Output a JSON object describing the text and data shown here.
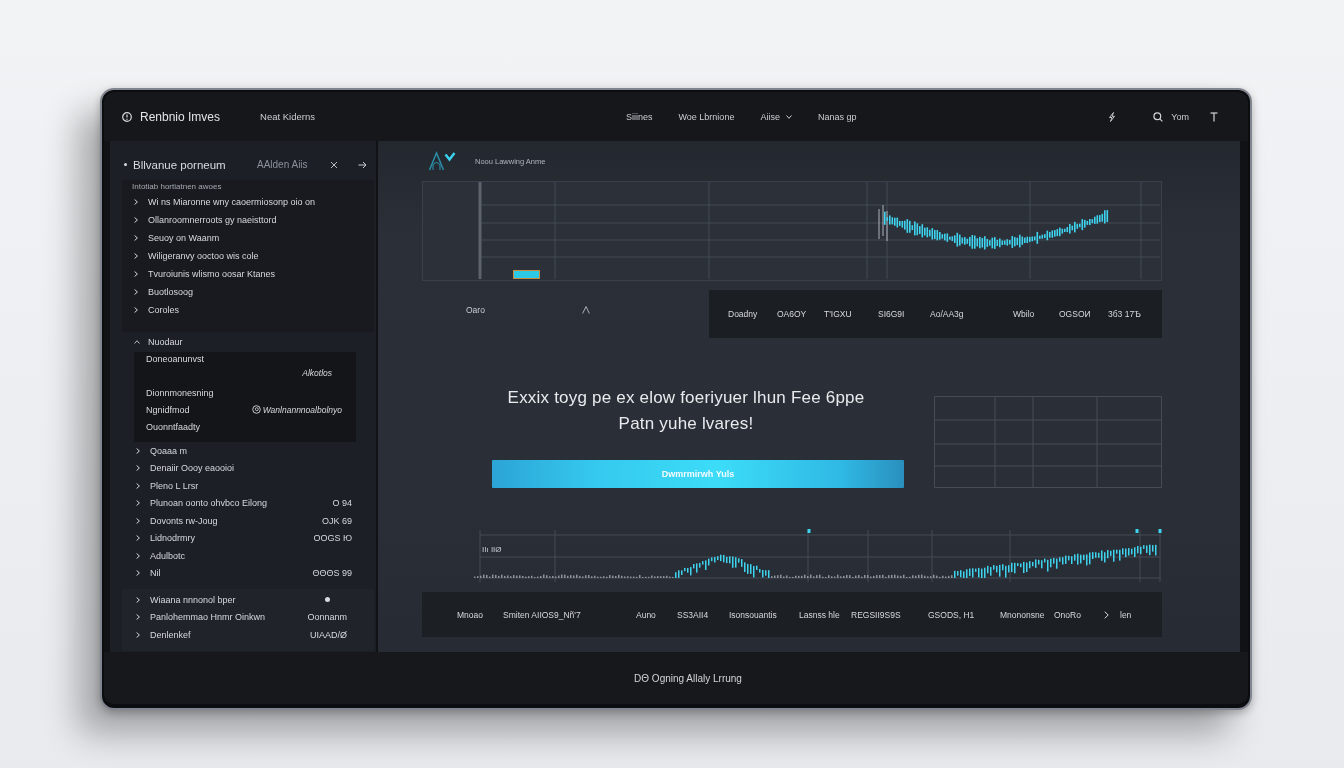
{
  "top_bar": {
    "brand": "Renbnio Imves",
    "workspace": "Neat Kiderns",
    "nav": [
      {
        "label": "Siiines",
        "dropdown": false
      },
      {
        "label": "Woe Lbrnione",
        "dropdown": false
      },
      {
        "label": "Aiise",
        "dropdown": true
      },
      {
        "label": "Nanas gp",
        "dropdown": false
      }
    ],
    "account": "Yom"
  },
  "sidebar": {
    "header": {
      "title": "Bllvanue porneum",
      "tag": "AAlden Aiis"
    },
    "caption": "Intotiab hortiatnen awoes",
    "items": [
      "Wi ns Miaronne wny caoermiosonp oio on",
      "Ollanroomnerroots gy naeisttord",
      "Seuoy on Waanm",
      "Wiligeranvy ooctoo wis cole",
      "Tvuroiunis wlismo oosar Ktanes",
      "Buotlosoog",
      "Coroles"
    ],
    "section": {
      "title": "Nuodaur",
      "expanded": true,
      "details": [
        {
          "kind": "plain",
          "label": "Doneoanunvst",
          "value": "Alkotlos"
        },
        {
          "kind": "plain",
          "label": "Dionnmonesning"
        },
        {
          "kind": "linked",
          "label": "Ngnidfmod",
          "value": "Wanlnannnoalbolnyo"
        },
        {
          "kind": "plain",
          "label": "Ouonntfaadty"
        }
      ],
      "items": [
        {
          "label": "Qoaaa m"
        },
        {
          "label": "Denaiir Oooy eaooioi"
        },
        {
          "label": "Pleno L Lrsr"
        },
        {
          "label": "Plunoan oonto ohvbco Eilong",
          "value": "O 94"
        },
        {
          "label": "Dovonts rw-Joug",
          "value": "OJK 69"
        },
        {
          "label": "Lidnodrmry",
          "value": "OOGS Ю"
        },
        {
          "label": "Adulbotc"
        },
        {
          "label": "Nil",
          "value": "ΘΘΘS 99"
        }
      ]
    },
    "footer_items": [
      {
        "kind": "status",
        "label": "Wiaana nnnonol bper"
      },
      {
        "kind": "value",
        "label": "Panlohemmao Hnmr Oinkwn",
        "value": "Oonnanm"
      },
      {
        "kind": "value",
        "label": "Denlenkef",
        "value": "UIAAD/Ø"
      }
    ]
  },
  "main": {
    "title": "Noou Lawwing Anme",
    "summary": {
      "label": "Oaro",
      "stats": [
        "Doadny",
        "OA6OY",
        "T'IGXU",
        "SI6G9I",
        "Ao/AA3g",
        "Wbilo",
        "OGSOИ",
        "3б3 17Ѣ"
      ]
    },
    "headline": "Exxix toyg pe ex elow foeriyuer lhun Fee 6ppe\nPatn yuhe lvares!",
    "button": "Dwmrmirwh Yuls",
    "activity_chart": {
      "label": "IIı IIØ"
    },
    "metrics": [
      "Mnoao",
      "Smiten AIIOS9_Nñ'7",
      "Auno",
      "SS3AII4",
      "Isonsouantis",
      "Lasnss hle",
      "REGSII9S9S",
      "GSODS, H1",
      "Mnononsne",
      "OnoRo"
    ],
    "more": "len"
  },
  "footer": {
    "text": "DΘ Ogning Allaly Lrrung"
  }
}
